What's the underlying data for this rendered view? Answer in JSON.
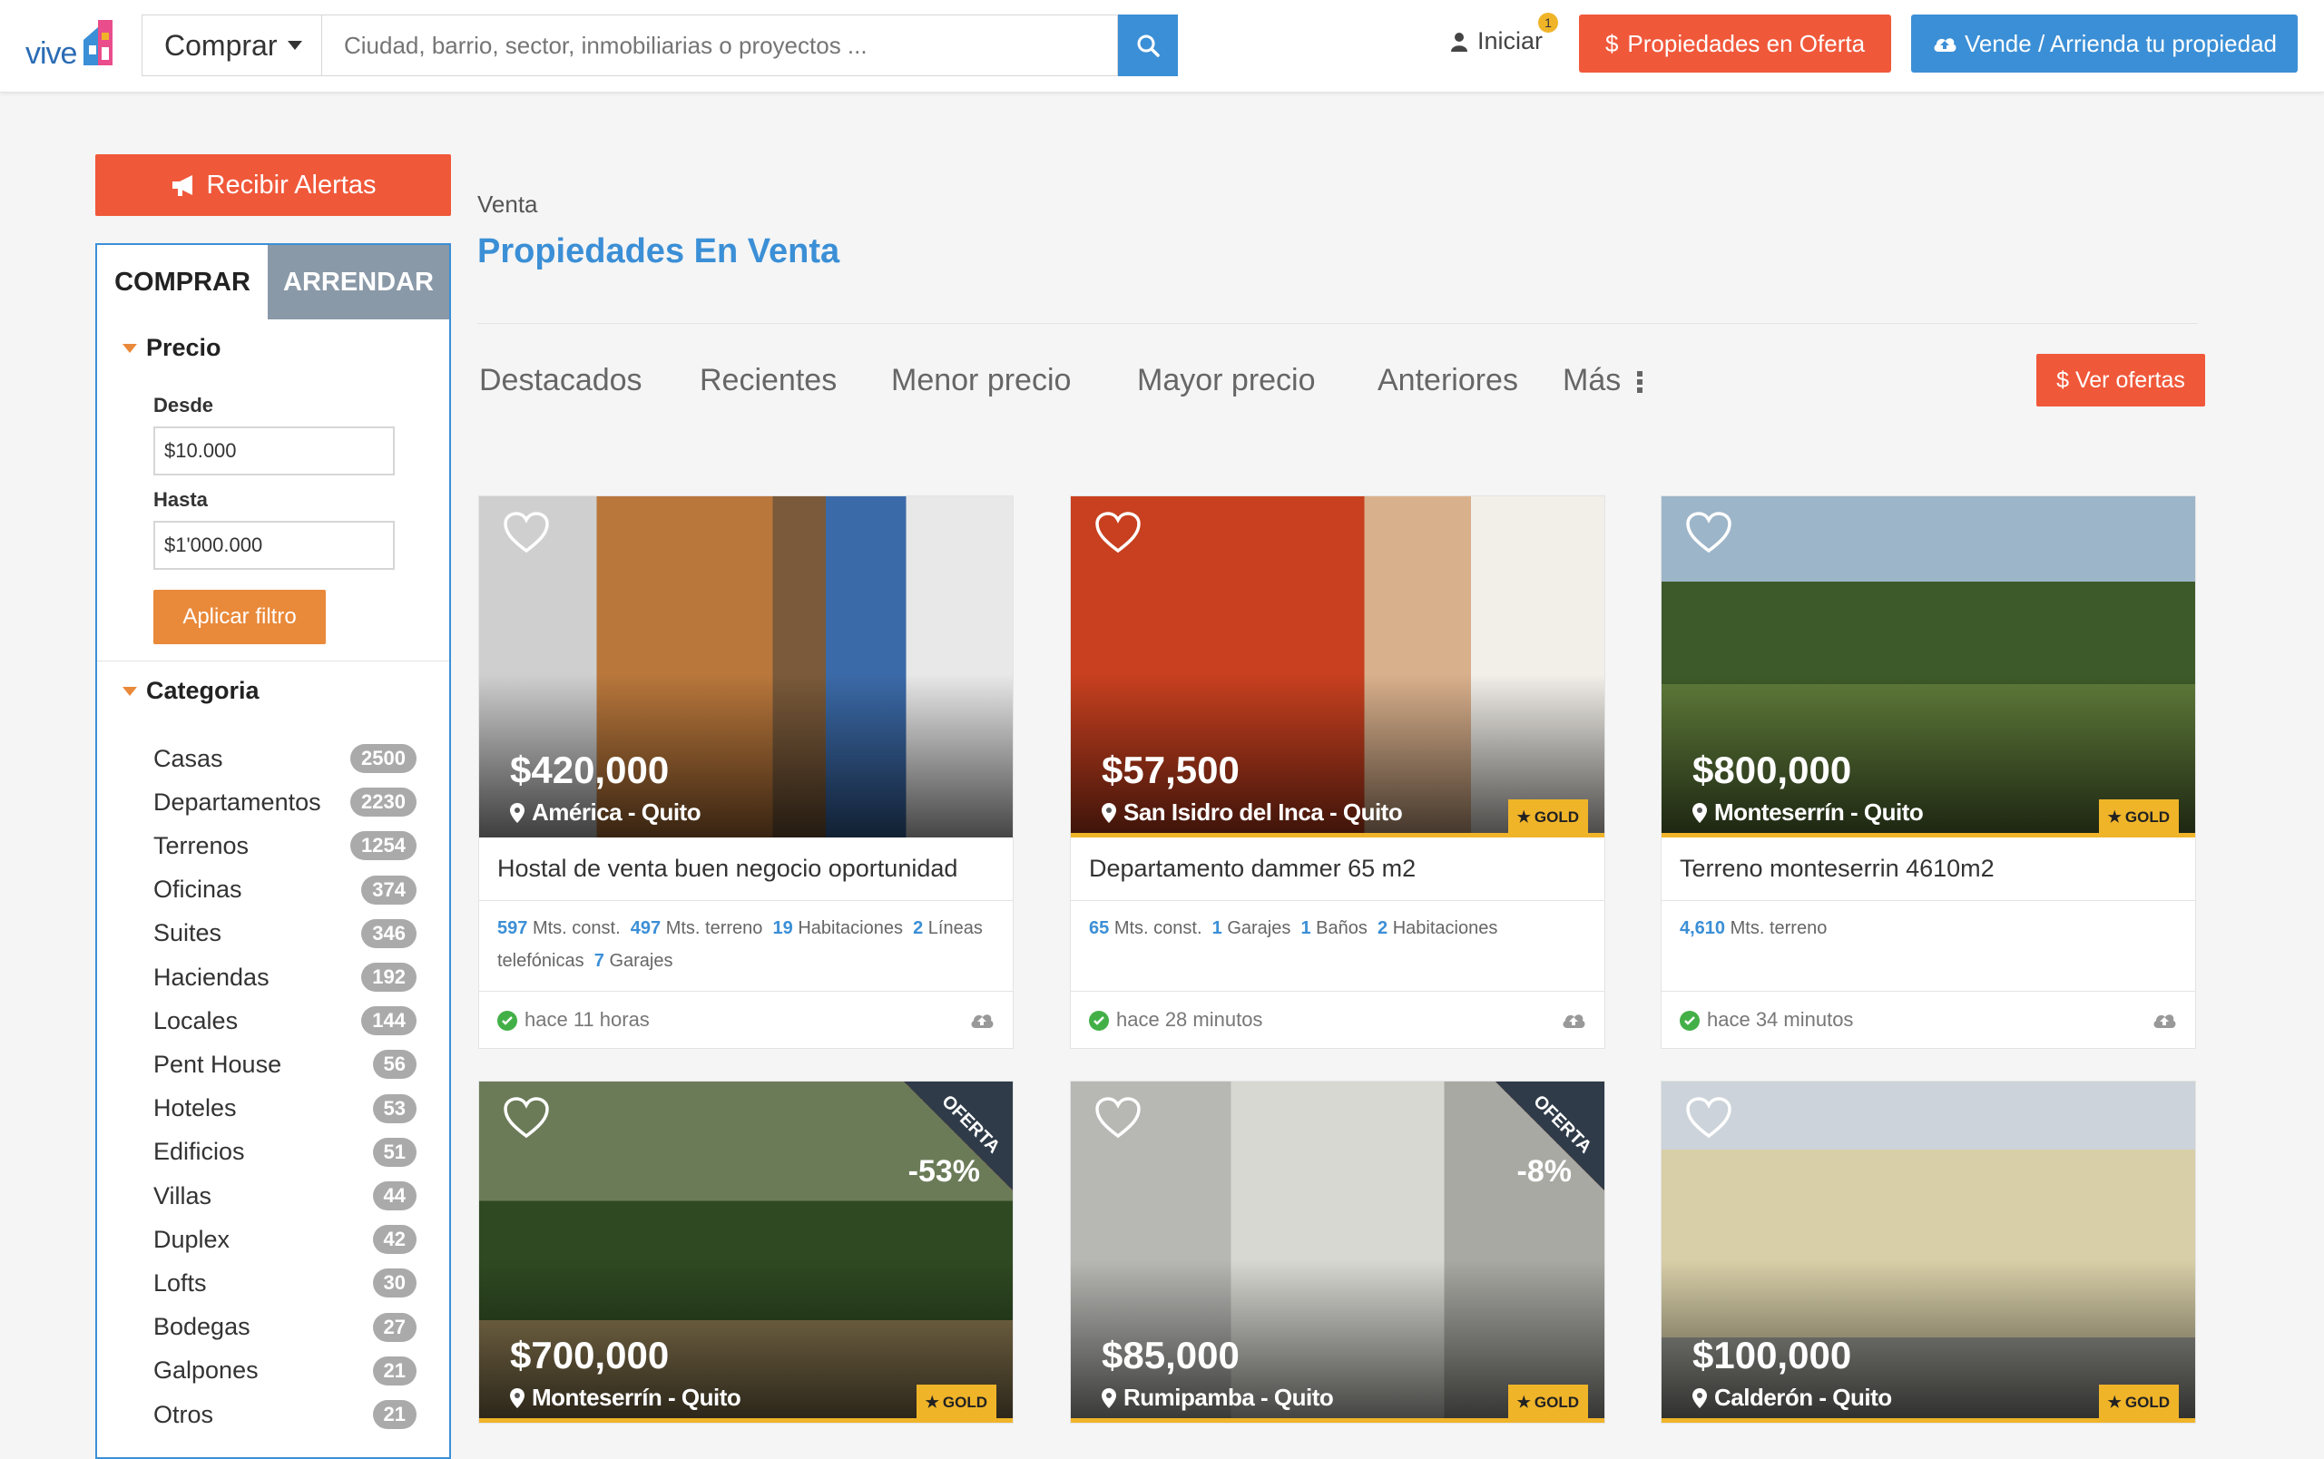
{
  "header": {
    "logo_text": "vive",
    "mode": "Comprar",
    "search_placeholder": "Ciudad, barrio, sector, inmobiliarias o proyectos ...",
    "login": "Iniciar",
    "notification_count": "1",
    "offers_button": "Propiedades en Oferta",
    "sell_button": "Vende / Arrienda tu propiedad",
    "dollar": "$"
  },
  "sidebar": {
    "alerts_button": "Recibir Alertas",
    "tabs": [
      "COMPRAR",
      "ARRENDAR"
    ],
    "price_title": "Precio",
    "from_label": "Desde",
    "from_value": "$10.000",
    "to_label": "Hasta",
    "to_value": "$1'000.000",
    "apply_button": "Aplicar filtro",
    "category_title": "Categoria",
    "categories": [
      {
        "name": "Casas",
        "count": "2500"
      },
      {
        "name": "Departamentos",
        "count": "2230"
      },
      {
        "name": "Terrenos",
        "count": "1254"
      },
      {
        "name": "Oficinas",
        "count": "374"
      },
      {
        "name": "Suites",
        "count": "346"
      },
      {
        "name": "Haciendas",
        "count": "192"
      },
      {
        "name": "Locales",
        "count": "144"
      },
      {
        "name": "Pent House",
        "count": "56"
      },
      {
        "name": "Hoteles",
        "count": "53"
      },
      {
        "name": "Edificios",
        "count": "51"
      },
      {
        "name": "Villas",
        "count": "44"
      },
      {
        "name": "Duplex",
        "count": "42"
      },
      {
        "name": "Lofts",
        "count": "30"
      },
      {
        "name": "Bodegas",
        "count": "27"
      },
      {
        "name": "Galpones",
        "count": "21"
      },
      {
        "name": "Otros",
        "count": "21"
      }
    ]
  },
  "main": {
    "breadcrumb": "Venta",
    "title": "Propiedades En Venta",
    "sort_options": [
      "Destacados",
      "Recientes",
      "Menor precio",
      "Mayor precio",
      "Anteriores",
      "Más"
    ],
    "offers_button": "$ Ver ofertas"
  },
  "cards": [
    {
      "price": "$420,000",
      "location": "América - Quito",
      "gold": false,
      "title": "Hostal de venta buen negocio oportunidad",
      "features": [
        [
          "597",
          "Mts. const."
        ],
        [
          "497",
          "Mts. terreno"
        ],
        [
          "19",
          "Habitaciones"
        ],
        [
          "2",
          "Líneas telefónicas"
        ],
        [
          "7",
          "Garajes"
        ]
      ],
      "time": "hace 11 horas"
    },
    {
      "price": "$57,500",
      "location": "San Isidro del Inca - Quito",
      "gold": true,
      "title": "Departamento dammer 65 m2",
      "features": [
        [
          "65",
          "Mts. const."
        ],
        [
          "1",
          "Garajes"
        ],
        [
          "1",
          "Baños"
        ],
        [
          "2",
          "Habitaciones"
        ]
      ],
      "time": "hace 28 minutos"
    },
    {
      "price": "$800,000",
      "location": "Monteserrín - Quito",
      "gold": true,
      "title": "Terreno monteserrin 4610m2",
      "features": [
        [
          "4,610",
          "Mts. terreno"
        ]
      ],
      "time": "hace 34 minutos"
    },
    {
      "price": "$700,000",
      "location": "Monteserrín - Quito",
      "gold": true,
      "offer": "-53%"
    },
    {
      "price": "$85,000",
      "location": "Rumipamba - Quito",
      "gold": true,
      "offer": "-8%"
    },
    {
      "price": "$100,000",
      "location": "Calderón - Quito",
      "gold": true
    }
  ],
  "labels": {
    "gold": "GOLD",
    "offer": "OFERTA"
  }
}
